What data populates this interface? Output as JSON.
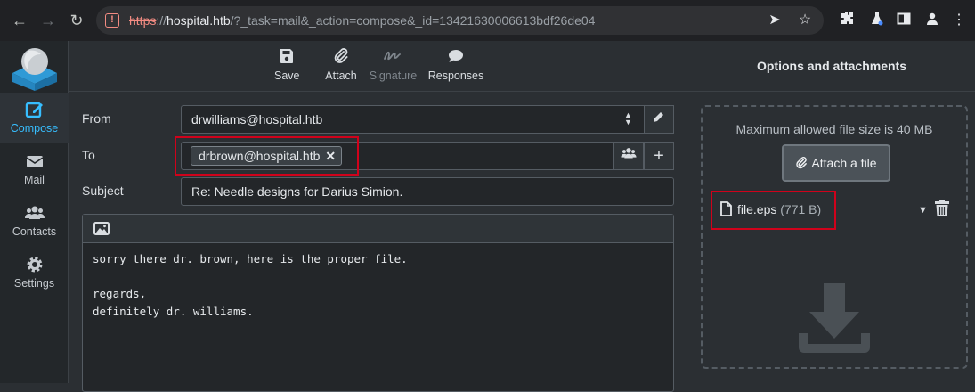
{
  "browser": {
    "url_scheme": "https",
    "url_host": "hospital.htb",
    "url_path": "/?_task=mail&_action=compose&_id=13421630006613bdf26de04"
  },
  "nav": {
    "items": [
      {
        "label": "Compose",
        "icon": "compose-icon"
      },
      {
        "label": "Mail",
        "icon": "envelope-icon"
      },
      {
        "label": "Contacts",
        "icon": "contacts-icon"
      },
      {
        "label": "Settings",
        "icon": "gear-icon"
      }
    ]
  },
  "toolbar": {
    "save": "Save",
    "attach": "Attach",
    "signature": "Signature",
    "responses": "Responses"
  },
  "compose": {
    "from_label": "From",
    "from_value": "drwilliams@hospital.htb",
    "to_label": "To",
    "to_recipient": "drbrown@hospital.htb",
    "subject_label": "Subject",
    "subject_value": "Re: Needle designs for Darius Simion.",
    "body": "sorry there dr. brown, here is the proper file.\n\nregards,\ndefinitely dr. williams."
  },
  "attachments": {
    "header": "Options and attachments",
    "max_size": "Maximum allowed file size is 40 MB",
    "attach_button": "Attach a file",
    "file_name": "file.eps",
    "file_size": "(771 B)"
  },
  "colors": {
    "accent": "#37beff",
    "highlight": "#d0021b"
  }
}
